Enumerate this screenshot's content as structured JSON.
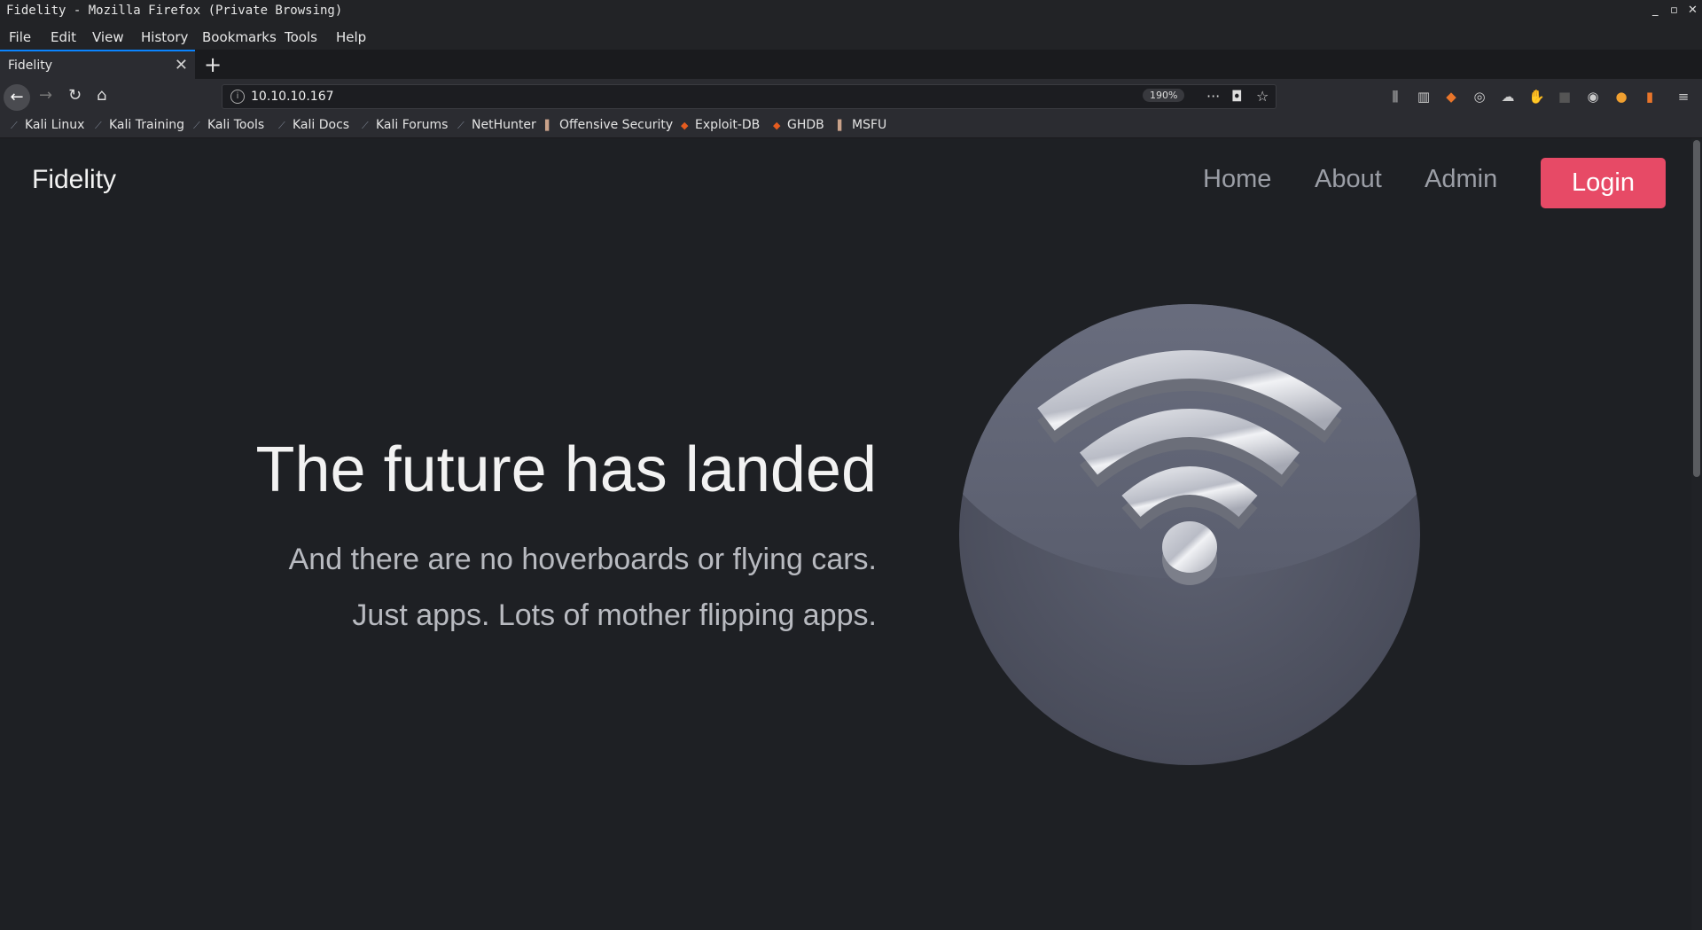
{
  "window": {
    "title": "Fidelity - Mozilla Firefox (Private Browsing)",
    "controls": [
      "_",
      "▫",
      "✕"
    ]
  },
  "menu": [
    {
      "label": "File"
    },
    {
      "label": "Edit"
    },
    {
      "label": "View"
    },
    {
      "label": "History"
    },
    {
      "label": "Bookmarks"
    },
    {
      "label": "Tools"
    },
    {
      "label": "Help"
    }
  ],
  "tab": {
    "label": "Fidelity",
    "close": "✕",
    "new": "+"
  },
  "url": {
    "value": "10.10.10.167",
    "zoom": "190%"
  },
  "bookmarks": [
    {
      "label": "Kali Linux",
      "icon": "kali-dragon-icon"
    },
    {
      "label": "Kali Training",
      "icon": "kali-dragon-icon"
    },
    {
      "label": "Kali Tools",
      "icon": "kali-dragon-icon"
    },
    {
      "label": "Kali Docs",
      "icon": "kali-dragon-icon"
    },
    {
      "label": "Kali Forums",
      "icon": "kali-dragon-icon"
    },
    {
      "label": "NetHunter",
      "icon": "kali-dragon-icon"
    },
    {
      "label": "Offensive Security",
      "icon": "offsec-icon"
    },
    {
      "label": "Exploit-DB",
      "icon": "exploitdb-icon"
    },
    {
      "label": "GHDB",
      "icon": "exploitdb-icon"
    },
    {
      "label": "MSFU",
      "icon": "offsec-icon"
    }
  ],
  "site": {
    "brand": "Fidelity",
    "nav": {
      "home": "Home",
      "about": "About",
      "admin": "Admin",
      "login": "Login"
    },
    "headline": "The future has landed",
    "sub1": "And there are no hoverboards or flying cars.",
    "sub2": "Just apps. Lots of mother flipping apps."
  },
  "colors": {
    "accent": "#e74a66",
    "page_bg": "#1e2024",
    "tab_highlight": "#0a84ff"
  }
}
